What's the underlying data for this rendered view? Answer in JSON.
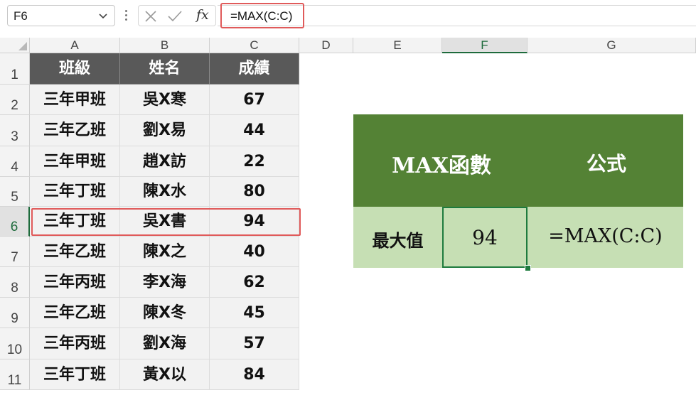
{
  "formula_bar": {
    "name_box": "F6",
    "fx_label": "fx",
    "formula": "=MAX(C:C)"
  },
  "columns": [
    "A",
    "B",
    "C",
    "D",
    "E",
    "F",
    "G"
  ],
  "rows": [
    "1",
    "2",
    "3",
    "4",
    "5",
    "6",
    "7",
    "8",
    "9",
    "10",
    "11"
  ],
  "selected_cell": {
    "column": "F",
    "row": "6"
  },
  "sheet": {
    "headers": [
      "班級",
      "姓名",
      "成績"
    ],
    "records": [
      [
        "三年甲班",
        "吳X寒",
        "67"
      ],
      [
        "三年乙班",
        "劉X易",
        "44"
      ],
      [
        "三年甲班",
        "趙X訪",
        "22"
      ],
      [
        "三年丁班",
        "陳X水",
        "80"
      ],
      [
        "三年丁班",
        "吳X書",
        "94"
      ],
      [
        "三年乙班",
        "陳X之",
        "40"
      ],
      [
        "三年丙班",
        "李X海",
        "62"
      ],
      [
        "三年乙班",
        "陳X冬",
        "45"
      ],
      [
        "三年丙班",
        "劉X海",
        "57"
      ],
      [
        "三年丁班",
        "黃X以",
        "84"
      ]
    ]
  },
  "max_table": {
    "header_func": "MAX函數",
    "header_formula": "公式",
    "row_label": "最大值",
    "row_value": "94",
    "row_formula": "=MAX(C:C)"
  },
  "colors": {
    "header_dark": "#595959",
    "cell_light": "#f2f2f2",
    "green_dark": "#548235",
    "green_light": "#c6dfb4",
    "highlight_red": "#e05a5a",
    "excel_green": "#1e6b3c"
  }
}
